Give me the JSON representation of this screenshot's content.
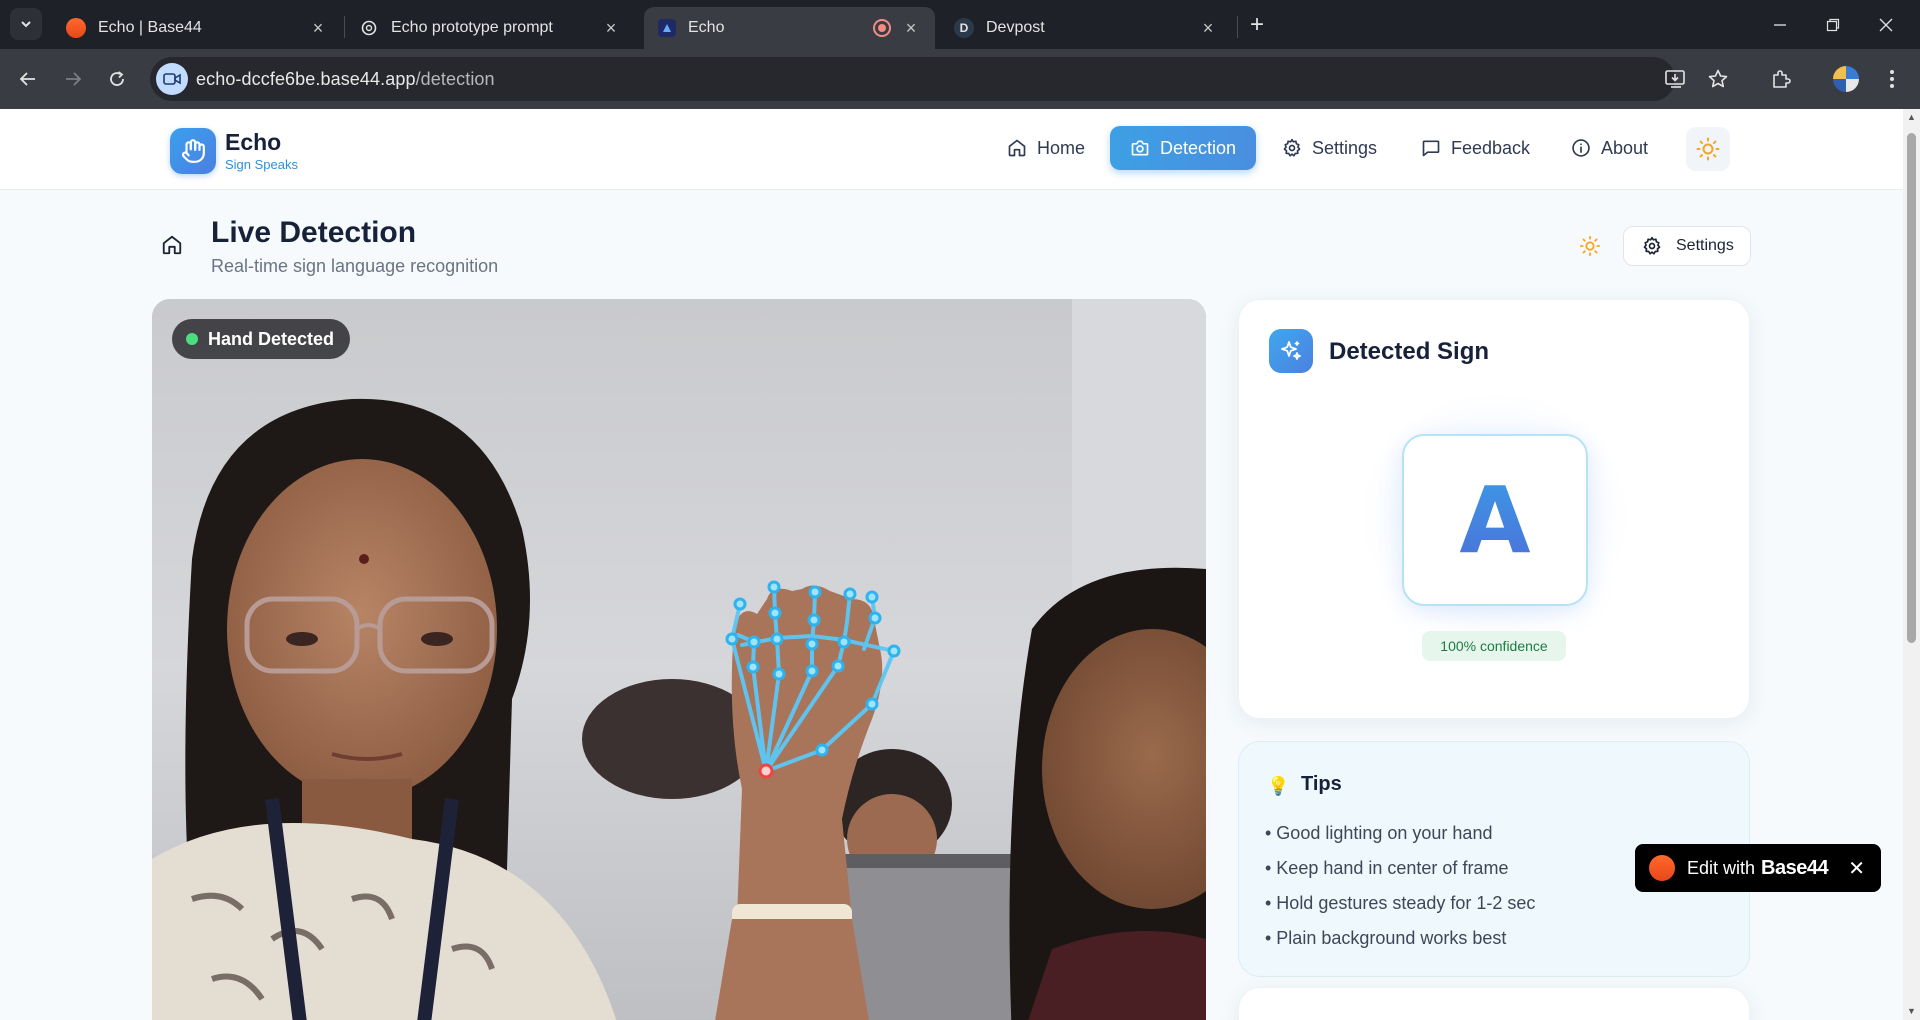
{
  "browser": {
    "tabs": [
      {
        "title": "Echo | Base44"
      },
      {
        "title": "Echo prototype prompt"
      },
      {
        "title": "Echo"
      },
      {
        "title": "Devpost",
        "favicon_letter": "D"
      }
    ],
    "url_host": "echo-dccfe6be.base44.app",
    "url_path": "/detection"
  },
  "header": {
    "logo_title": "Echo",
    "logo_subtitle": "Sign Speaks",
    "nav": [
      {
        "label": "Home",
        "icon": "home-icon"
      },
      {
        "label": "Detection",
        "icon": "camera-icon"
      },
      {
        "label": "Settings",
        "icon": "gear-icon"
      },
      {
        "label": "Feedback",
        "icon": "message-icon"
      },
      {
        "label": "About",
        "icon": "info-icon"
      }
    ]
  },
  "page": {
    "title": "Live Detection",
    "subtitle": "Real-time sign language recognition",
    "settings_label": "Settings"
  },
  "video": {
    "status_badge": "Hand Detected"
  },
  "detected": {
    "title": "Detected Sign",
    "letter": "A",
    "confidence": "100% confidence"
  },
  "tips": {
    "title": "Tips",
    "items": [
      "• Good lighting on your hand",
      "• Keep hand in center of frame",
      "• Hold gestures steady for 1-2 sec",
      "• Plain background works best"
    ]
  },
  "edit_widget": {
    "prefix": "Edit with",
    "brand": "Base44"
  },
  "colors": {
    "accent": "#3da0e4",
    "success": "#4ade80",
    "landmark": "#5cc8f5"
  }
}
